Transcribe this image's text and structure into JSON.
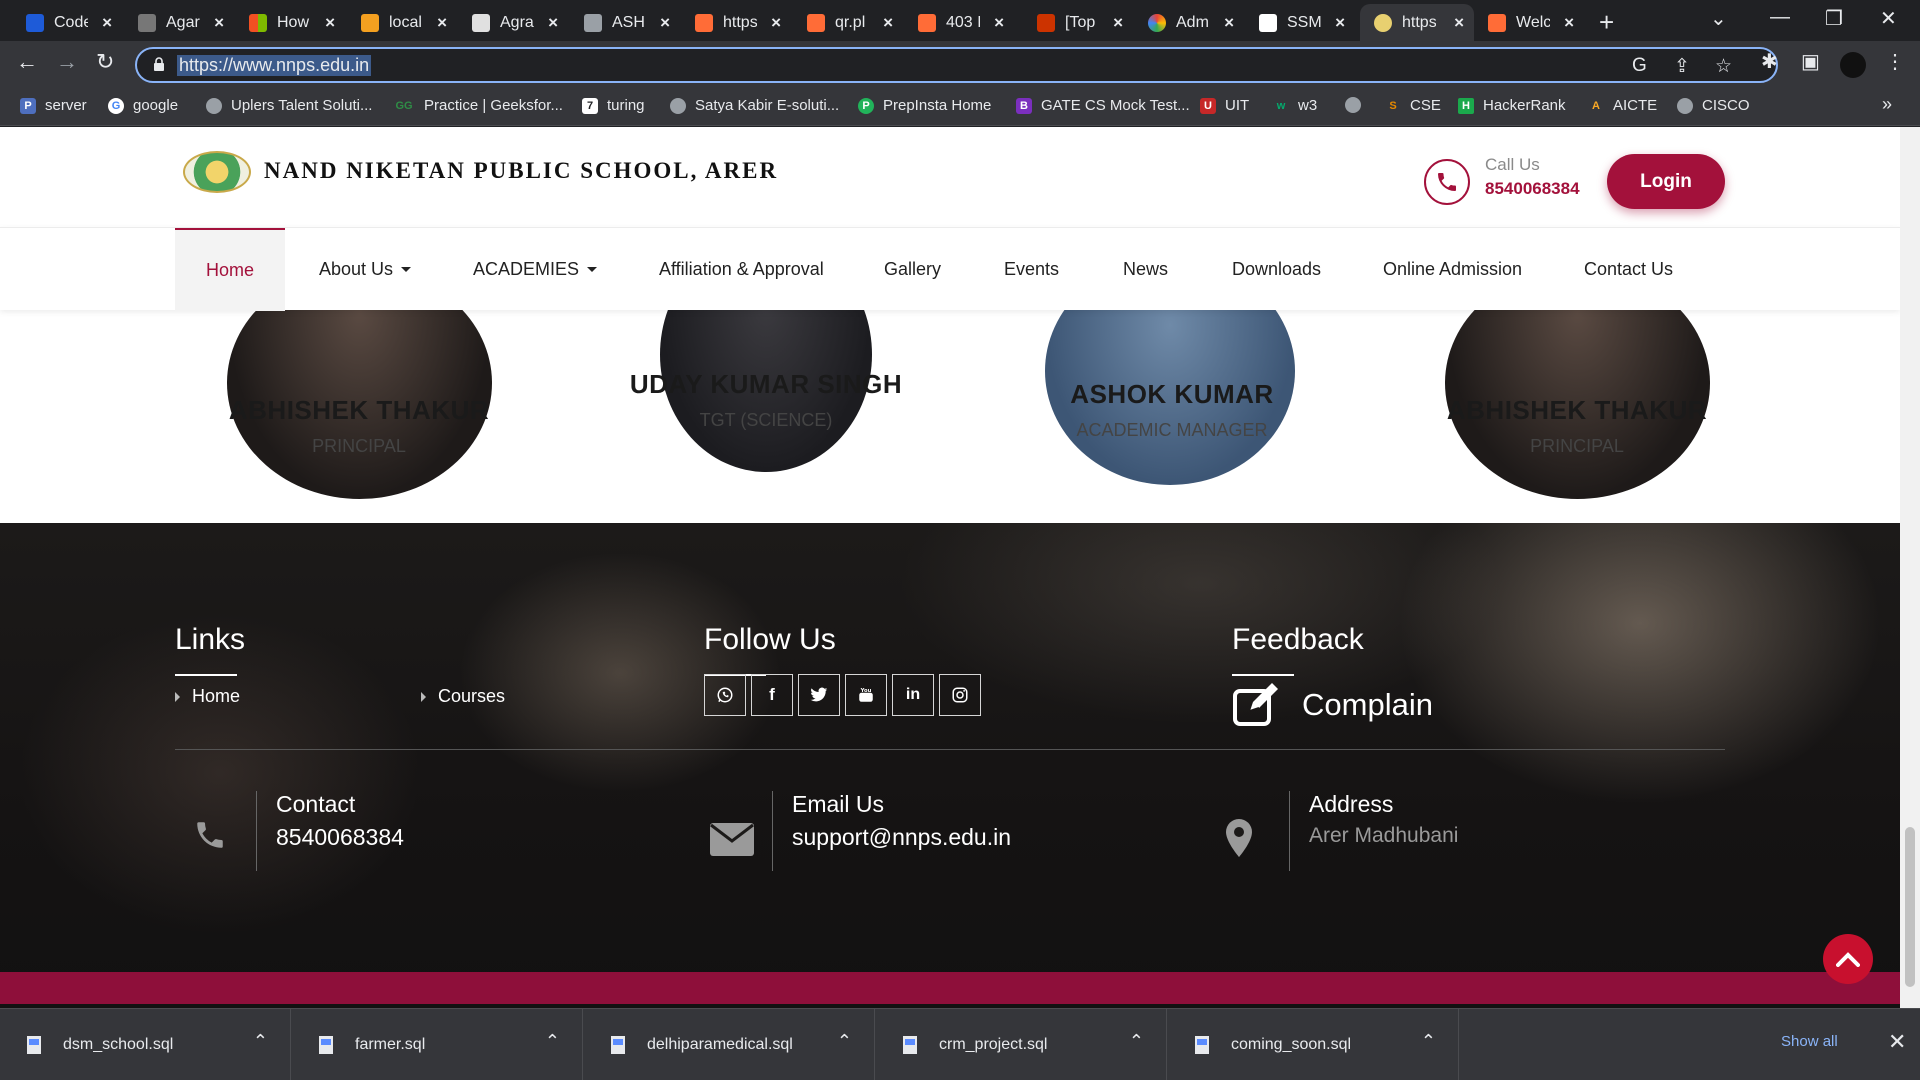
{
  "browser": {
    "tabs": [
      {
        "title": "Code",
        "color": "#1e5bd8"
      },
      {
        "title": "Agar",
        "color": "#777777"
      },
      {
        "title": "How",
        "color": "#f25022"
      },
      {
        "title": "local",
        "color": "#f4a020"
      },
      {
        "title": "Agra",
        "color": "#e0e0e0"
      },
      {
        "title": "ASH",
        "color": "#9aa0a6"
      },
      {
        "title": "https",
        "color": "#ff6c37"
      },
      {
        "title": "qr.pl",
        "color": "#ff6c37"
      },
      {
        "title": "403 I",
        "color": "#ff6c37"
      },
      {
        "title": "[Top",
        "color": "#cc3300"
      },
      {
        "title": "Adm",
        "color": "#34a853"
      },
      {
        "title": "SSM",
        "color": "#ffffff"
      },
      {
        "title": "https",
        "color": "#e8d070"
      },
      {
        "title": "Welc",
        "color": "#ff6c37"
      }
    ],
    "active_tab_index": 12,
    "url": "https://www.nnps.edu.in",
    "bookmarks": [
      {
        "label": "server",
        "icon": "P",
        "color": "#4e6fbe"
      },
      {
        "label": "google",
        "icon": "G",
        "color": "#ffffff"
      },
      {
        "label": "Uplers Talent Soluti...",
        "icon": "",
        "color": "#9aa0a6"
      },
      {
        "label": "Practice | Geeksfor...",
        "icon": "GG",
        "color": "#2f8d46"
      },
      {
        "label": "turing",
        "icon": "7",
        "color": "#202124"
      },
      {
        "label": "Satya Kabir E-soluti...",
        "icon": "",
        "color": "#9aa0a6"
      },
      {
        "label": "PrepInsta Home",
        "icon": "P",
        "color": "#21b35a"
      },
      {
        "label": "GATE CS Mock Test...",
        "icon": "B",
        "color": "#7b2fbe"
      },
      {
        "label": "UIT",
        "icon": "U",
        "color": "#c62828"
      },
      {
        "label": "w3",
        "icon": "w",
        "color": "#04aa6d"
      },
      {
        "label": "",
        "icon": "",
        "color": "#9aa0a6"
      },
      {
        "label": "CSE",
        "icon": "S",
        "color": "#e68a00"
      },
      {
        "label": "HackerRank",
        "icon": "H",
        "color": "#1ba94c"
      },
      {
        "label": "AICTE",
        "icon": "A",
        "color": "#f9a825"
      },
      {
        "label": "CISCO",
        "icon": "",
        "color": "#9aa0a6"
      }
    ],
    "bookmarks_overflow": "»"
  },
  "site": {
    "school_name": "NAND NIKETAN PUBLIC SCHOOL, ARER",
    "call_label": "Call Us",
    "call_number": "8540068384",
    "login_label": "Login",
    "brand_color": "#a3113b",
    "nav": [
      {
        "label": "Home",
        "active": true
      },
      {
        "label": "About Us",
        "dropdown": true
      },
      {
        "label": "ACADEMIES",
        "dropdown": true
      },
      {
        "label": "Affiliation & Approval"
      },
      {
        "label": "Gallery"
      },
      {
        "label": "Events"
      },
      {
        "label": "News"
      },
      {
        "label": "Downloads"
      },
      {
        "label": "Online Admission"
      },
      {
        "label": "Contact Us"
      }
    ],
    "staff": [
      {
        "name": "ABHISHEK THAKUR",
        "role": "PRINCIPAL"
      },
      {
        "name": "UDAY KUMAR SINGH",
        "role": "TGT (SCIENCE)"
      },
      {
        "name": "ASHOK KUMAR",
        "role": "ACADEMIC MANAGER"
      },
      {
        "name": "ABHISHEK THAKUR",
        "role": "PRINCIPAL"
      }
    ]
  },
  "footer": {
    "links_heading": "Links",
    "links": [
      "Home",
      "Courses"
    ],
    "follow_heading": "Follow Us",
    "social_icons": [
      "whatsapp-icon",
      "facebook-icon",
      "twitter-icon",
      "youtube-icon",
      "linkedin-icon",
      "instagram-icon"
    ],
    "feedback_heading": "Feedback",
    "complain_label": "Complain",
    "contact": {
      "title": "Contact",
      "value": "8540068384"
    },
    "email": {
      "title": "Email Us",
      "value": "support@nnps.edu.in"
    },
    "address": {
      "title": "Address",
      "value": "Arer Madhubani"
    }
  },
  "downloads": {
    "files": [
      "dsm_school.sql",
      "farmer.sql",
      "delhiparamedical.sql",
      "crm_project.sql",
      "coming_soon.sql"
    ],
    "show_all_label": "Show all"
  }
}
